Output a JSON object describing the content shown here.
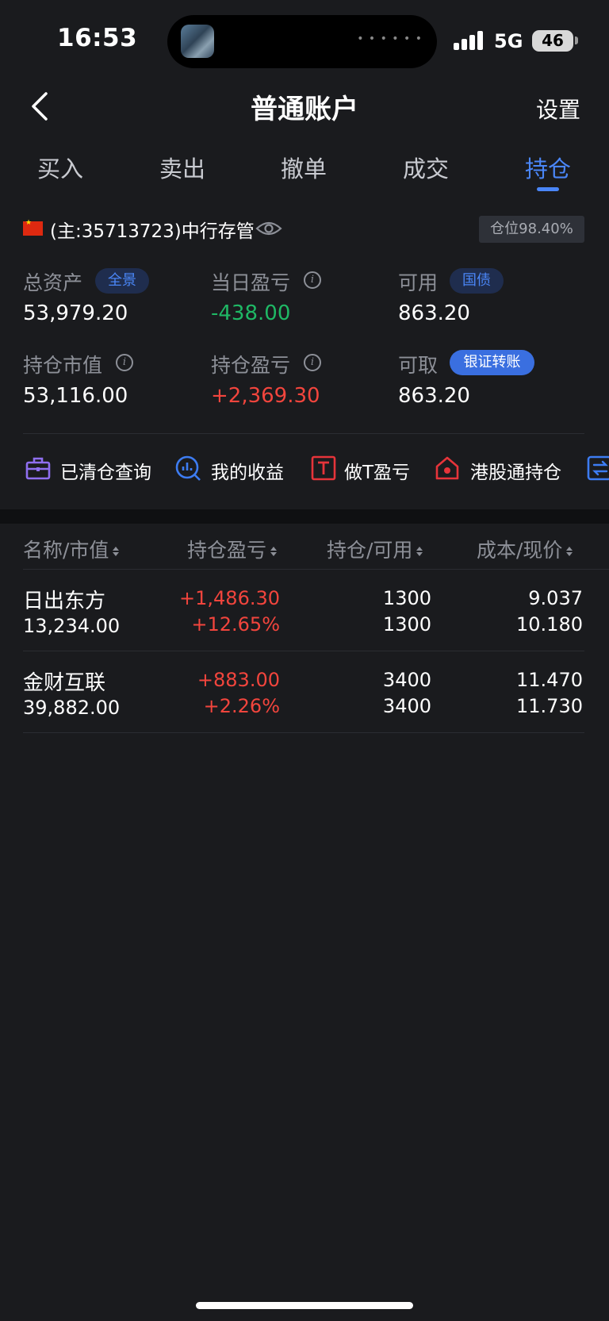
{
  "status_bar": {
    "time": "16:53",
    "network": "5G",
    "battery": "46"
  },
  "header": {
    "title": "普通账户",
    "settings_label": "设置"
  },
  "tabs": [
    {
      "label": "买入"
    },
    {
      "label": "卖出"
    },
    {
      "label": "撤单"
    },
    {
      "label": "成交"
    },
    {
      "label": "持仓",
      "active": true
    }
  ],
  "account": {
    "label": "(主:35713723)中行存管",
    "position_ratio": "仓位98.40%"
  },
  "metrics": {
    "total_assets": {
      "label": "总资产",
      "tag": "全景",
      "value": "53,979.20"
    },
    "daily_pnl": {
      "label": "当日盈亏",
      "value": "-438.00"
    },
    "available": {
      "label": "可用",
      "tag": "国债",
      "value": "863.20"
    },
    "market_value": {
      "label": "持仓市值",
      "value": "53,116.00"
    },
    "position_pnl": {
      "label": "持仓盈亏",
      "value": "+2,369.30"
    },
    "withdrawable": {
      "label": "可取",
      "tag": "银证转账",
      "value": "863.20"
    }
  },
  "quick_menu": [
    {
      "label": "已清仓查询",
      "icon": "briefcase-icon"
    },
    {
      "label": "我的收益",
      "icon": "chart-search-icon"
    },
    {
      "label": "做T盈亏",
      "icon": "t-box-icon"
    },
    {
      "label": "港股通持仓",
      "icon": "hk-house-icon"
    },
    {
      "label": "",
      "icon": "transfer-icon"
    }
  ],
  "table": {
    "headers": [
      "名称/市值",
      "持仓盈亏",
      "持仓/可用",
      "成本/现价"
    ],
    "rows": [
      {
        "name": "日出东方",
        "market_value": "13,234.00",
        "pnl": "+1,486.30",
        "pnl_pct": "+12.65%",
        "holding": "1300",
        "available": "1300",
        "cost": "9.037",
        "price": "10.180"
      },
      {
        "name": "金财互联",
        "market_value": "39,882.00",
        "pnl": "+883.00",
        "pnl_pct": "+2.26%",
        "holding": "3400",
        "available": "3400",
        "cost": "11.470",
        "price": "11.730"
      }
    ]
  },
  "colors": {
    "accent": "#4a86f7",
    "up": "#f2453d",
    "down": "#1fb865",
    "background": "#1a1b1e"
  }
}
